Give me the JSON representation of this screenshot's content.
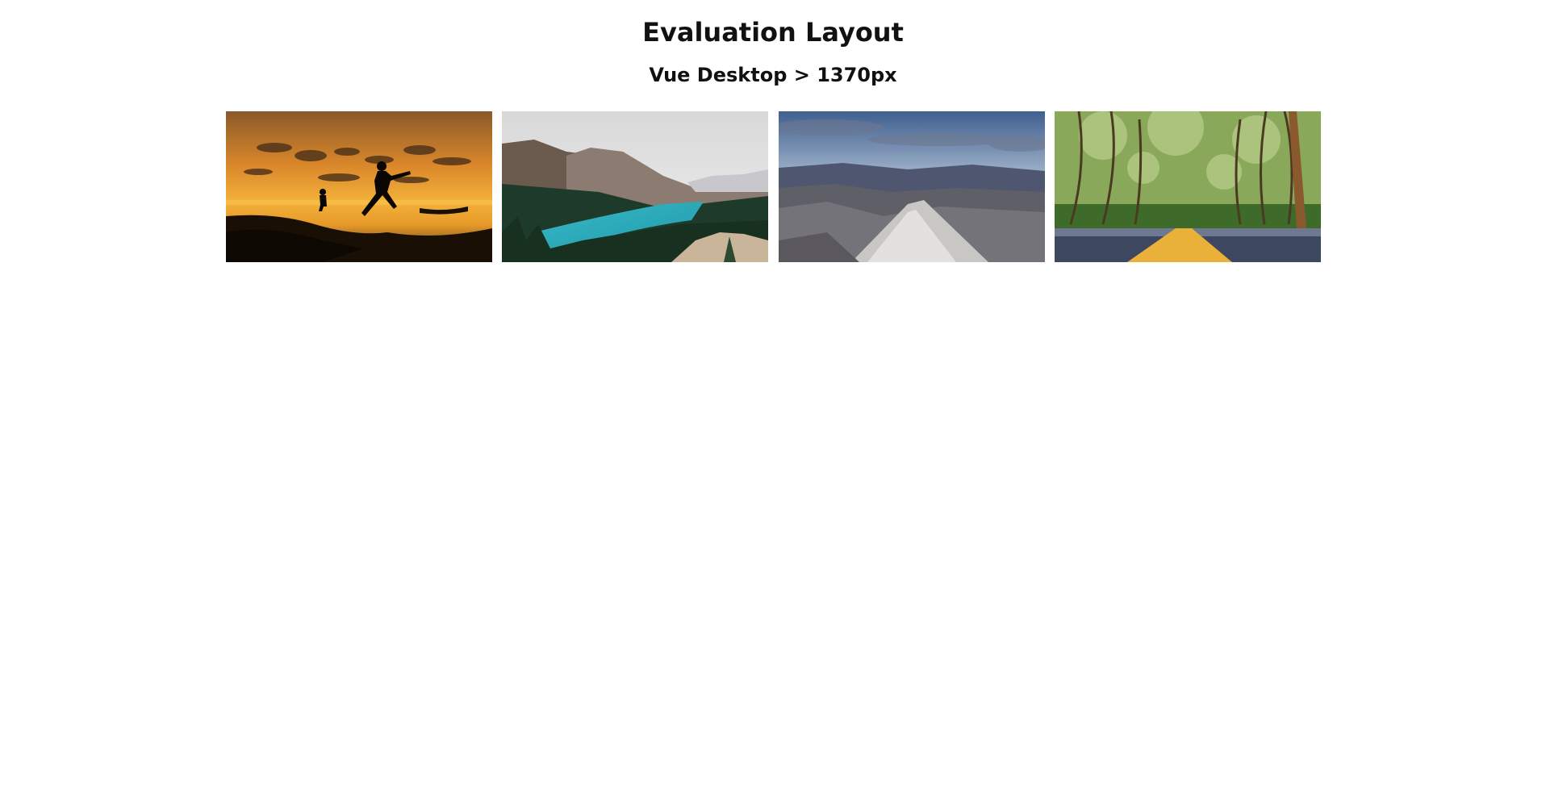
{
  "header": {
    "title": "Evaluation Layout",
    "subtitle": "Vue Desktop > 1370px"
  },
  "gallery": {
    "images": [
      {
        "name": "sunset-silhouette-image"
      },
      {
        "name": "mountain-lake-image"
      },
      {
        "name": "rocky-ridge-image"
      },
      {
        "name": "tree-lined-road-image"
      }
    ]
  }
}
